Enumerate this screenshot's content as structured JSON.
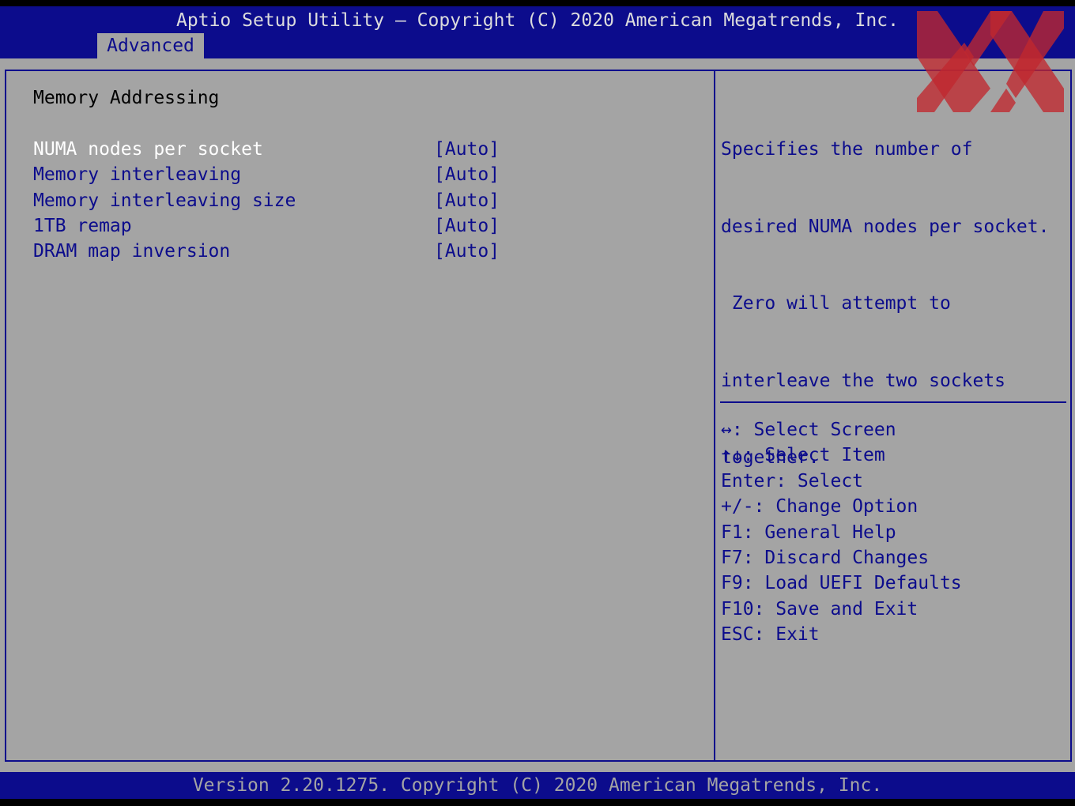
{
  "header": {
    "title": "Aptio Setup Utility – Copyright (C) 2020 American Megatrends, Inc.",
    "tab": "Advanced"
  },
  "main": {
    "section_title": "Memory Addressing",
    "settings": [
      {
        "label": "NUMA nodes per socket",
        "value": "[Auto]"
      },
      {
        "label": "Memory interleaving",
        "value": "[Auto]"
      },
      {
        "label": "Memory interleaving size",
        "value": "[Auto]"
      },
      {
        "label": "1TB remap",
        "value": "[Auto]"
      },
      {
        "label": "DRAM map inversion",
        "value": "[Auto]"
      }
    ]
  },
  "help": {
    "lines": [
      "Specifies the number of",
      "desired NUMA nodes per socket.",
      " Zero will attempt to",
      "interleave the two sockets",
      "together."
    ]
  },
  "keys": [
    "↔: Select Screen",
    "↑↓: Select Item",
    "Enter: Select",
    "+/-: Change Option",
    "F1: General Help",
    "F7: Discard Changes",
    "F9: Load UEFI Defaults",
    "F10: Save and Exit",
    "ESC: Exit"
  ],
  "footer": {
    "text": "Version 2.20.1275. Copyright (C) 2020 American Megatrends, Inc."
  },
  "watermark": {
    "icon": "xx-logo-icon",
    "color": "#c0282e"
  },
  "colors": {
    "bios_blue": "#0c0c8c",
    "bios_gray": "#a4a4a4",
    "highlight": "#ffffff"
  }
}
